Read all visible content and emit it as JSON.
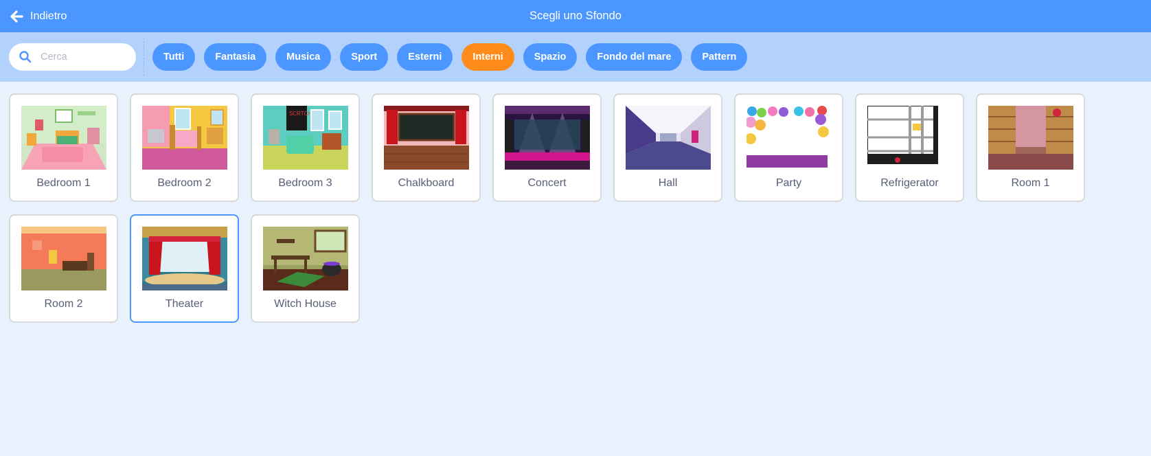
{
  "header": {
    "back_label": "Indietro",
    "title": "Scegli uno Sfondo"
  },
  "search": {
    "placeholder": "Cerca",
    "value": ""
  },
  "tags": [
    {
      "label": "Tutti",
      "active": false
    },
    {
      "label": "Fantasia",
      "active": false
    },
    {
      "label": "Musica",
      "active": false
    },
    {
      "label": "Sport",
      "active": false
    },
    {
      "label": "Esterni",
      "active": false
    },
    {
      "label": "Interni",
      "active": true
    },
    {
      "label": "Spazio",
      "active": false
    },
    {
      "label": "Fondo del mare",
      "active": false
    },
    {
      "label": "Pattern",
      "active": false
    }
  ],
  "backdrops": [
    {
      "name": "Bedroom 1",
      "selected": false
    },
    {
      "name": "Bedroom 2",
      "selected": false
    },
    {
      "name": "Bedroom 3",
      "selected": false
    },
    {
      "name": "Chalkboard",
      "selected": false
    },
    {
      "name": "Concert",
      "selected": false
    },
    {
      "name": "Hall",
      "selected": false
    },
    {
      "name": "Party",
      "selected": false
    },
    {
      "name": "Refrigerator",
      "selected": false
    },
    {
      "name": "Room 1",
      "selected": false
    },
    {
      "name": "Room 2",
      "selected": false
    },
    {
      "name": "Theater",
      "selected": true
    },
    {
      "name": "Witch House",
      "selected": false
    }
  ],
  "colors": {
    "header": "#4c97ff",
    "filter_bar": "#b3d1fd",
    "active_tag": "#ff8c1a",
    "tag": "#4c97ff",
    "background": "#e9f1fc"
  }
}
